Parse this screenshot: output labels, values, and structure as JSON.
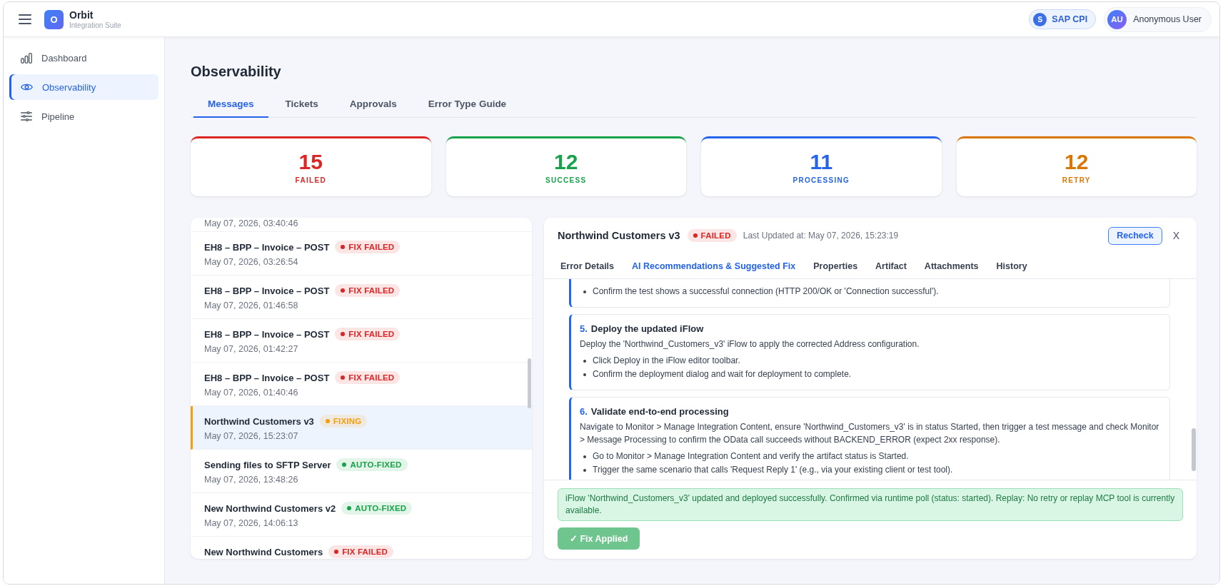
{
  "topbar": {
    "logo_letter": "O",
    "app_name": "Orbit",
    "app_subtitle": "Integration Suite",
    "system": {
      "initial": "S",
      "label": "SAP CPI"
    },
    "user": {
      "initials": "AU",
      "name": "Anonymous User"
    }
  },
  "sidebar": {
    "items": [
      {
        "label": "Dashboard",
        "selected": false
      },
      {
        "label": "Observability",
        "selected": true
      },
      {
        "label": "Pipeline",
        "selected": false
      }
    ]
  },
  "page": {
    "title": "Observability",
    "tabs": [
      {
        "label": "Messages",
        "selected": true
      },
      {
        "label": "Tickets",
        "selected": false
      },
      {
        "label": "Approvals",
        "selected": false
      },
      {
        "label": "Error Type Guide",
        "selected": false
      }
    ]
  },
  "stats": [
    {
      "value": "15",
      "label": "FAILED",
      "color": "#dc2626"
    },
    {
      "value": "12",
      "label": "SUCCESS",
      "color": "#16a34a"
    },
    {
      "value": "11",
      "label": "PROCESSING",
      "color": "#2563eb"
    },
    {
      "value": "12",
      "label": "RETRY",
      "color": "#d97706"
    }
  ],
  "messages": [
    {
      "date": "May 07, 2026, 03:40:46",
      "selected": false
    },
    {
      "name": "EH8 – BPP – Invoice – POST",
      "status": {
        "text": "FIX FAILED",
        "color": "#dc2626"
      },
      "date": "May 07, 2026, 03:26:54",
      "selected": false
    },
    {
      "name": "EH8 – BPP – Invoice – POST",
      "status": {
        "text": "FIX FAILED",
        "color": "#dc2626"
      },
      "date": "May 07, 2026, 01:46:58",
      "selected": false
    },
    {
      "name": "EH8 – BPP – Invoice – POST",
      "status": {
        "text": "FIX FAILED",
        "color": "#dc2626"
      },
      "date": "May 07, 2026, 01:42:27",
      "selected": false
    },
    {
      "name": "EH8 – BPP – Invoice – POST",
      "status": {
        "text": "FIX FAILED",
        "color": "#dc2626"
      },
      "date": "May 07, 2026, 01:40:46",
      "selected": false
    },
    {
      "name": "Northwind Customers v3",
      "status": {
        "text": "FIXING",
        "color": "#f59e0b"
      },
      "date": "May 07, 2026, 15:23:07",
      "selected": true
    },
    {
      "name": "Sending files to SFTP Server",
      "status": {
        "text": "AUTO-FIXED",
        "color": "#16a34a"
      },
      "date": "May 07, 2026, 13:48:26",
      "selected": false
    },
    {
      "name": "New Northwind Customers v2",
      "status": {
        "text": "AUTO-FIXED",
        "color": "#16a34a"
      },
      "date": "May 07, 2026, 14:06:13",
      "selected": false
    },
    {
      "name": "New Northwind Customers",
      "status": {
        "text": "FIX FAILED",
        "color": "#dc2626"
      },
      "selected": false
    }
  ],
  "detail": {
    "title": "Northwind Customers v3",
    "status": {
      "text": "FAILED",
      "color": "#dc2626"
    },
    "updated": "Last Updated at: May 07, 2026, 15:23:19",
    "recheck": "Recheck",
    "close": "X",
    "tabs": [
      {
        "label": "Error Details",
        "selected": false
      },
      {
        "label": "AI Recommendations & Suggested Fix",
        "selected": true
      },
      {
        "label": "Properties",
        "selected": false
      },
      {
        "label": "Artifact",
        "selected": false
      },
      {
        "label": "Attachments",
        "selected": false
      },
      {
        "label": "History",
        "selected": false
      }
    ],
    "steps": [
      {
        "bullets": [
          "Confirm the test shows a successful connection (HTTP 200/OK or 'Connection successful')."
        ]
      },
      {
        "number": "5.",
        "title": "Deploy the updated iFlow",
        "description": "Deploy the 'Northwind_Customers_v3' iFlow to apply the corrected Address configuration.",
        "bullets": [
          "Click Deploy in the iFlow editor toolbar.",
          "Confirm the deployment dialog and wait for deployment to complete."
        ]
      },
      {
        "number": "6.",
        "title": "Validate end-to-end processing",
        "description": "Navigate to Monitor > Manage Integration Content, ensure 'Northwind_Customers_v3' is in status Started, then trigger a test message and check Monitor > Message Processing to confirm the OData call succeeds without BACKEND_ERROR (expect 2xx response).",
        "bullets": [
          "Go to Monitor > Manage Integration Content and verify the artifact status is Started.",
          "Trigger the same scenario that calls 'Request Reply 1' (e.g., via your existing client or test tool)."
        ]
      }
    ],
    "result": {
      "message": "iFlow 'Northwind_Customers_v3' updated and deployed successfully. Confirmed via runtime poll (status: started). Replay: No retry or replay MCP tool is currently available.",
      "button": {
        "label": "✓ Fix Applied",
        "disabled": true
      }
    }
  }
}
